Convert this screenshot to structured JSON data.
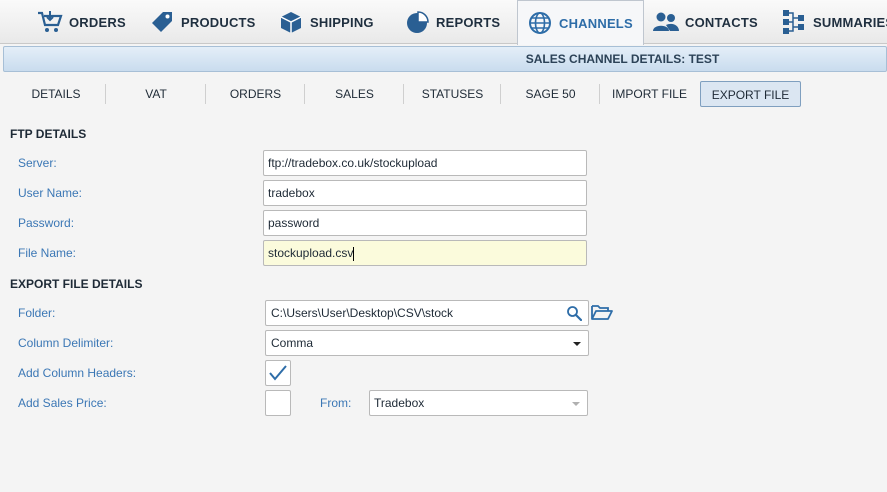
{
  "nav": {
    "items": [
      {
        "label": "ORDERS",
        "icon": "cart-icon"
      },
      {
        "label": "PRODUCTS",
        "icon": "tag-icon"
      },
      {
        "label": "SHIPPING",
        "icon": "box-icon"
      },
      {
        "label": "REPORTS",
        "icon": "pie-chart-icon"
      },
      {
        "label": "CHANNELS",
        "icon": "globe-icon",
        "active": true
      },
      {
        "label": "CONTACTS",
        "icon": "people-icon"
      },
      {
        "label": "SUMMARIES",
        "icon": "hierarchy-icon"
      }
    ]
  },
  "header": {
    "title": "SALES CHANNEL DETAILS: TEST"
  },
  "tabs": [
    {
      "label": "DETAILS"
    },
    {
      "label": "VAT"
    },
    {
      "label": "ORDERS"
    },
    {
      "label": "SALES"
    },
    {
      "label": "STATUSES"
    },
    {
      "label": "SAGE 50"
    },
    {
      "label": "IMPORT FILE"
    },
    {
      "label": "EXPORT FILE",
      "active": true
    }
  ],
  "ftp": {
    "heading": "FTP DETAILS",
    "server_label": "Server:",
    "server_value": "ftp://tradebox.co.uk/stockupload",
    "username_label": "User Name:",
    "username_value": "tradebox",
    "password_label": "Password:",
    "password_value": "password",
    "filename_label": "File Name:",
    "filename_value": "stockupload.csv"
  },
  "export": {
    "heading": "EXPORT FILE DETAILS",
    "folder_label": "Folder:",
    "folder_value": "C:\\Users\\User\\Desktop\\CSV\\stock",
    "delimiter_label": "Column Delimiter:",
    "delimiter_value": "Comma",
    "headers_label": "Add Column Headers:",
    "headers_checked": true,
    "price_label": "Add Sales Price:",
    "price_checked": false,
    "from_label": "From:",
    "from_value": "Tradebox"
  },
  "colors": {
    "accent": "#2e6da8",
    "label": "#3b77b5",
    "focus_bg": "#fbfbdc"
  }
}
